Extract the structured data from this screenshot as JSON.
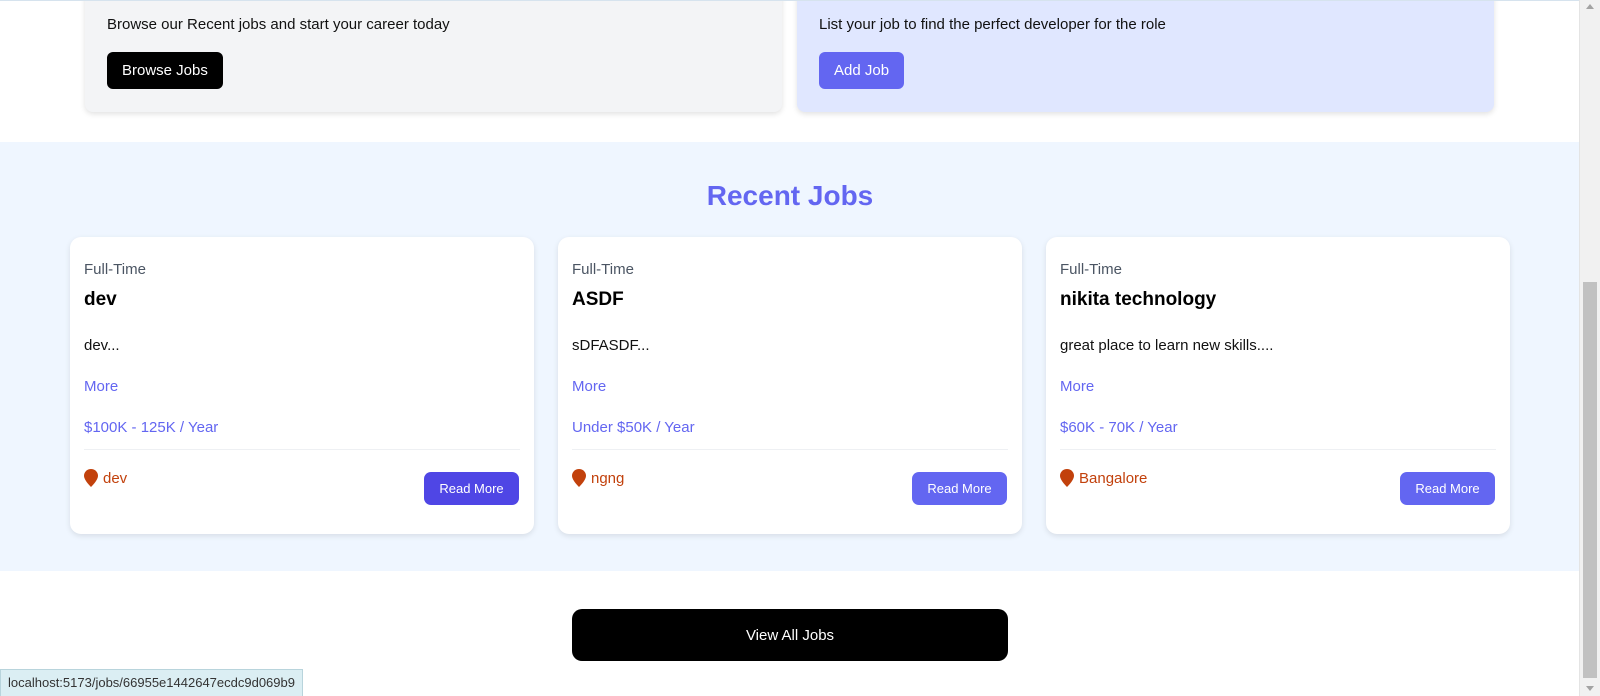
{
  "promo": {
    "developers": {
      "text": "Browse our Recent jobs and start your career today",
      "button": "Browse Jobs"
    },
    "employers": {
      "text": "List your job to find the perfect developer for the role",
      "button": "Add Job"
    }
  },
  "recent_jobs": {
    "title": "Recent Jobs",
    "jobs": [
      {
        "type": "Full-Time",
        "title": "dev",
        "description": "dev...",
        "more": "More",
        "salary": "$100K - 125K / Year",
        "location": "dev",
        "button": "Read More"
      },
      {
        "type": "Full-Time",
        "title": "ASDF",
        "description": "sDFASDF...",
        "more": "More",
        "salary": "Under $50K / Year",
        "location": "ngng",
        "button": "Read More"
      },
      {
        "type": "Full-Time",
        "title": "nikita technology",
        "description": "great place to learn new skills....",
        "more": "More",
        "salary": "$60K - 70K / Year",
        "location": "Bangalore",
        "button": "Read More"
      }
    ]
  },
  "view_all": "View All Jobs",
  "status_url": "localhost:5173/jobs/66955e1442647ecdc9d069b9",
  "colors": {
    "accent": "#6366f1",
    "accent_hover": "#4f46e5",
    "location": "#c2410c",
    "section_bg": "#eff6ff"
  }
}
